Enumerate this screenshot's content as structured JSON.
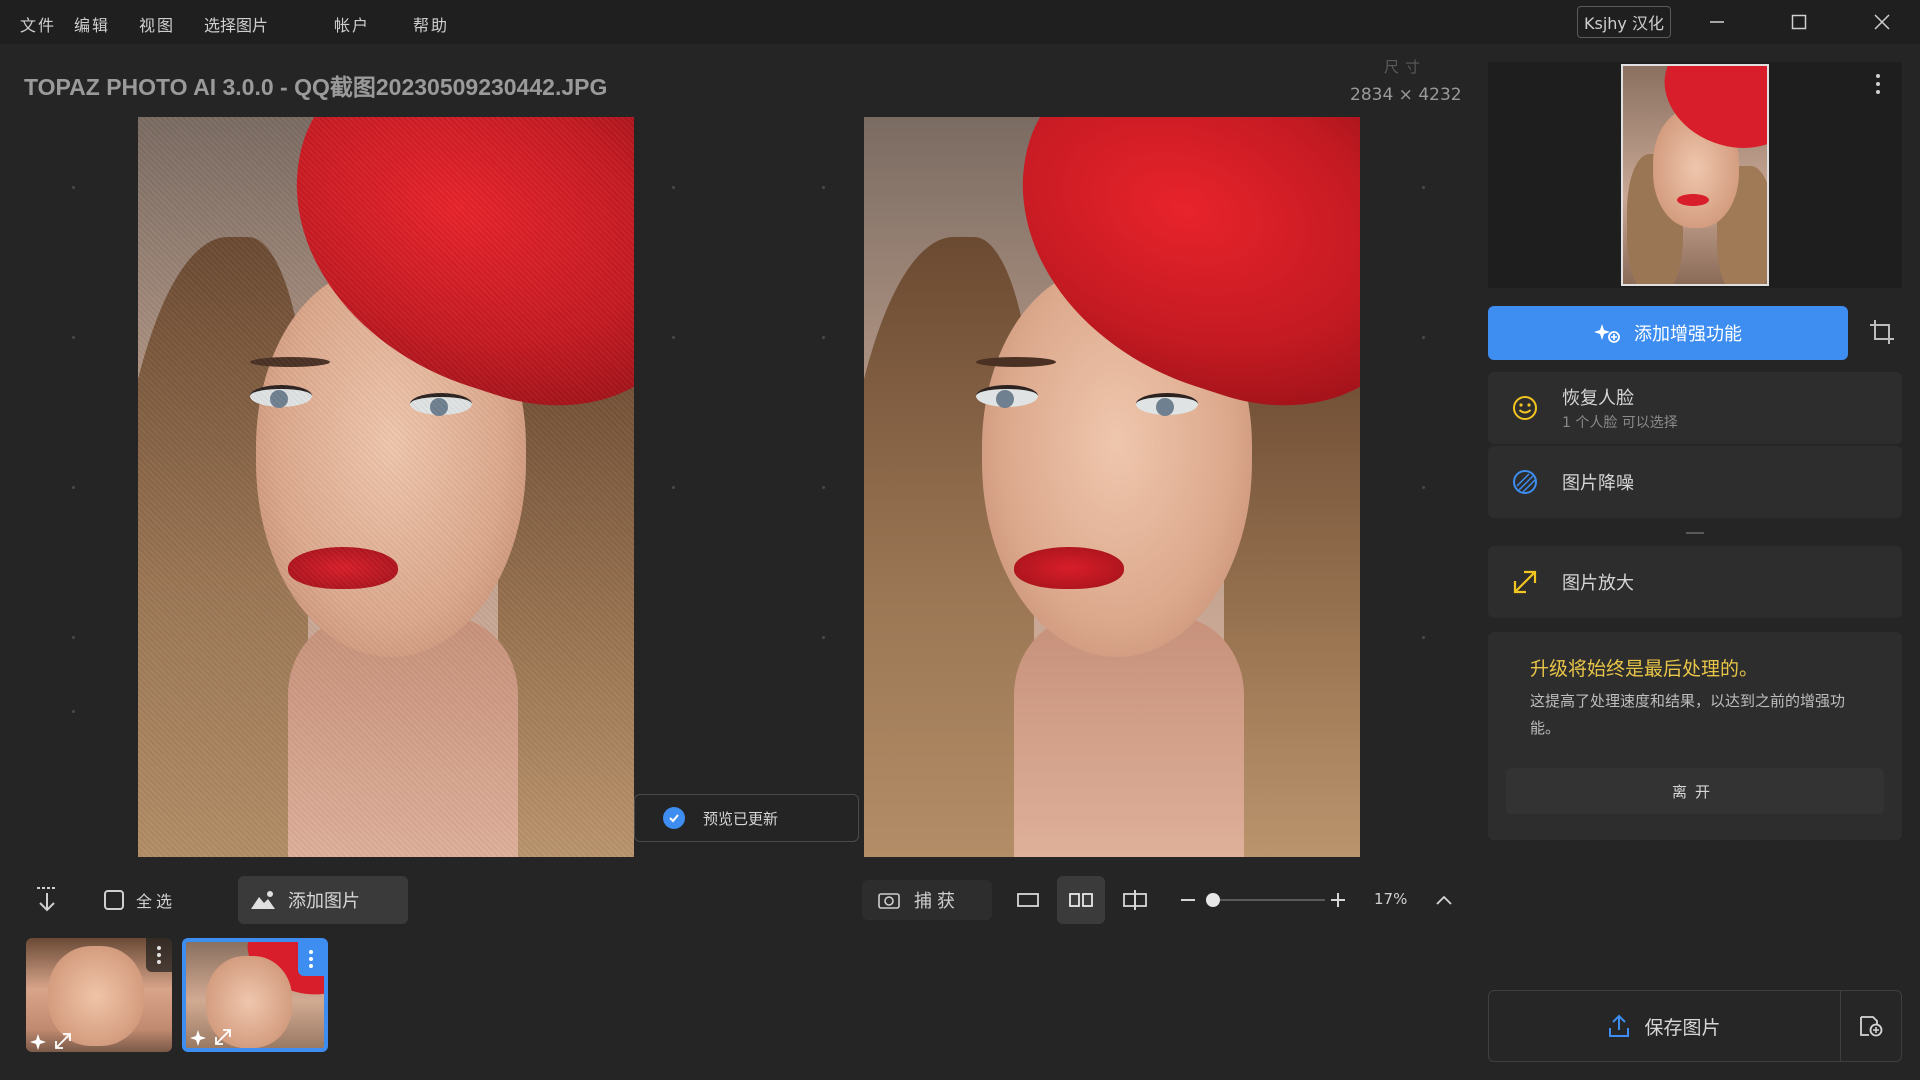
{
  "menu": {
    "items": [
      "文件",
      "编辑",
      "视图",
      "选择图片",
      "帐户",
      "帮助"
    ],
    "language_button": "Ksjhy 汉化"
  },
  "header": {
    "title": "TOPAZ PHOTO AI 3.0.0 - QQ截图20230509230442.JPG",
    "size_label": "尺寸",
    "size_value": "2834 × 4232"
  },
  "canvas": {
    "preview_status": "预览已更新"
  },
  "toolbar": {
    "select_all": "全选",
    "add_image": "添加图片",
    "capture": "捕获",
    "zoom": "17%",
    "zoom_level": 0.17
  },
  "enhancements": {
    "add_button": "添加增强功能",
    "items": [
      {
        "title": "恢复人脸",
        "subtitle": "1 个人脸 可以选择",
        "icon": "smiley-icon",
        "color": "#f2c521"
      },
      {
        "title": "图片降噪",
        "subtitle": "",
        "icon": "denoise-icon",
        "color": "#3d8ef0"
      },
      {
        "title": "图片放大",
        "subtitle": "",
        "icon": "upscale-icon",
        "color": "#f2c521"
      }
    ]
  },
  "info": {
    "title": "升级将始终是最后处理的。",
    "body": "这提高了处理速度和结果，以达到之前的增强功能。",
    "leave": "离开"
  },
  "save": {
    "label": "保存图片"
  },
  "colors": {
    "accent": "#3d8ef0",
    "warning": "#e8c447",
    "background": "#252526"
  }
}
